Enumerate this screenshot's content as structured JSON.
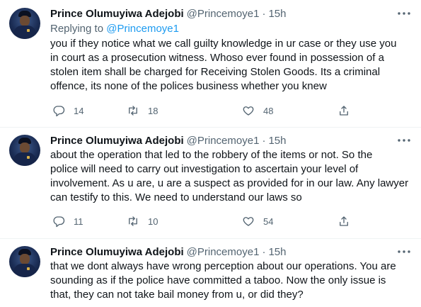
{
  "tweets": [
    {
      "name": "Prince Olumuyiwa Adejobi",
      "handle": "@Princemoye1",
      "separator": "·",
      "time": "15h",
      "replying_label": "Replying to ",
      "replying_to": "@Princemoye1",
      "lines": [
        "you if they notice what we call guilty knowledge in ur case  or they use you",
        "in court as a prosecution witness. Whoso ever found in possession of a",
        "stolen item shall be charged for Receiving Stolen Goods. Its a criminal",
        "offence, its none of the polices business whether you knew"
      ],
      "replies": "14",
      "retweets": "18",
      "likes": "48"
    },
    {
      "name": "Prince Olumuyiwa Adejobi",
      "handle": "@Princemoye1",
      "separator": "·",
      "time": "15h",
      "lines": [
        "about the operation that led to the robbery of the items or not. So the",
        "police will need to carry out investigation to ascertain your level of",
        "involvement. As u are, u are a suspect as provided for in our law. Any lawyer",
        "can testify to this. We need to understand our laws so"
      ],
      "replies": "11",
      "retweets": "10",
      "likes": "54"
    },
    {
      "name": "Prince Olumuyiwa Adejobi",
      "handle": "@Princemoye1",
      "separator": "·",
      "time": "15h",
      "lines": [
        "that we dont always have wrong perception about our operations. You are",
        "sounding as if the police have committed a taboo. Now the only issue is",
        "that, they can not take bail money from u, or did they?"
      ]
    }
  ],
  "colors": {
    "accent": "#1d9bf0",
    "secondary_text": "#536471",
    "text": "#0f1419"
  },
  "icons": [
    "avatar-photo",
    "more-dots-icon",
    "reply-icon",
    "retweet-icon",
    "like-icon",
    "share-icon"
  ]
}
